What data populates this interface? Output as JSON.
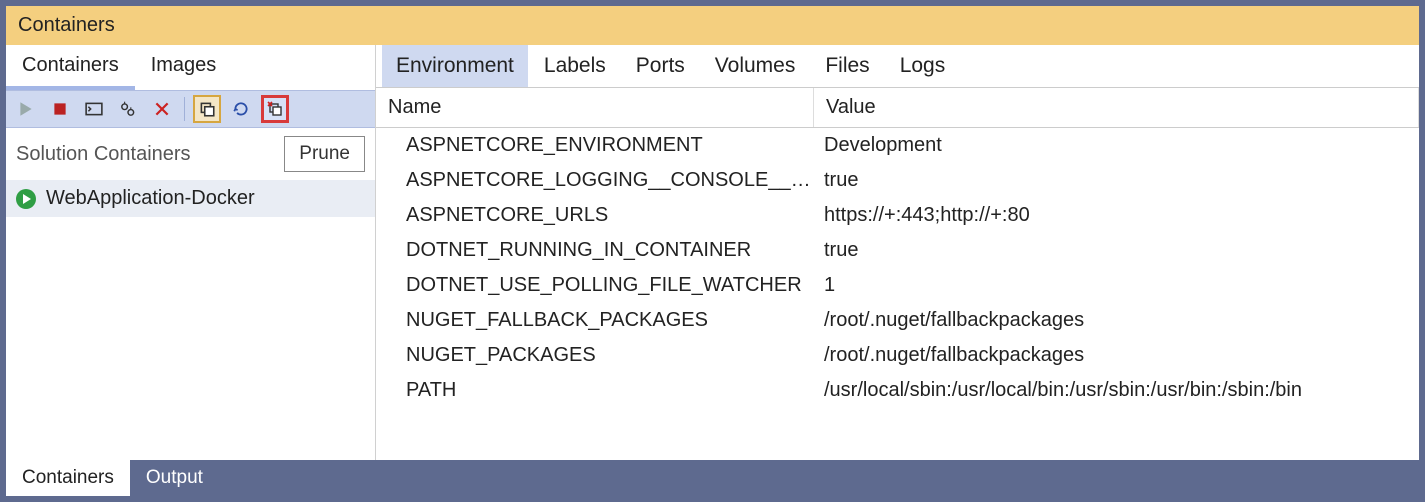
{
  "title": "Containers",
  "leftTabs": [
    "Containers",
    "Images"
  ],
  "leftActiveTab": 0,
  "sidebar": {
    "groupLabel": "Solution Containers",
    "pruneLabel": "Prune",
    "items": [
      "WebApplication-Docker"
    ]
  },
  "rightTabs": [
    "Environment",
    "Labels",
    "Ports",
    "Volumes",
    "Files",
    "Logs"
  ],
  "rightActiveTab": 0,
  "grid": {
    "columns": [
      "Name",
      "Value"
    ],
    "rows": [
      {
        "name": "ASPNETCORE_ENVIRONMENT",
        "value": "Development"
      },
      {
        "name": "ASPNETCORE_LOGGING__CONSOLE__DISA...",
        "value": "true"
      },
      {
        "name": "ASPNETCORE_URLS",
        "value": "https://+:443;http://+:80"
      },
      {
        "name": "DOTNET_RUNNING_IN_CONTAINER",
        "value": "true"
      },
      {
        "name": "DOTNET_USE_POLLING_FILE_WATCHER",
        "value": "1"
      },
      {
        "name": "NUGET_FALLBACK_PACKAGES",
        "value": "/root/.nuget/fallbackpackages"
      },
      {
        "name": "NUGET_PACKAGES",
        "value": "/root/.nuget/fallbackpackages"
      },
      {
        "name": "PATH",
        "value": "/usr/local/sbin:/usr/local/bin:/usr/sbin:/usr/bin:/sbin:/bin"
      }
    ]
  },
  "bottomTabs": [
    "Containers",
    "Output"
  ],
  "bottomActiveTab": 0
}
